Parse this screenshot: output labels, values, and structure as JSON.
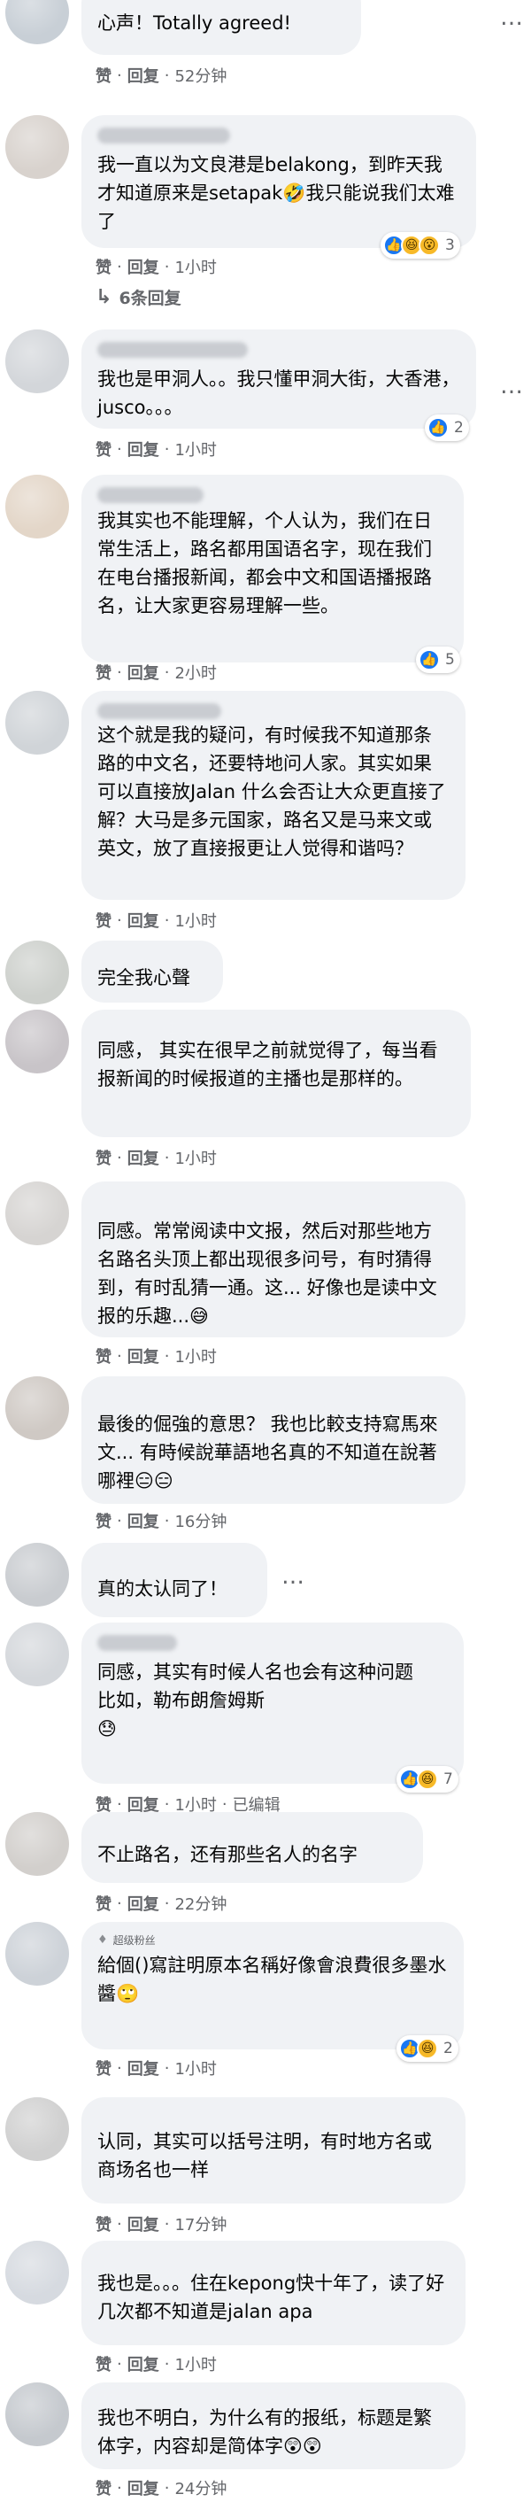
{
  "actions": {
    "like": "赞",
    "reply": "回复",
    "separator": "·",
    "more": "…"
  },
  "comments": [
    {
      "text": "心声！Totally agreed!",
      "time": "52分钟",
      "edited": ""
    },
    {
      "text": "我一直以为文良港是belakong，到昨天我才知道原来是setapak🤣我只能说我们太难了",
      "time": "1小时",
      "edited": "",
      "reactions": {
        "icons": [
          "like-icon",
          "haha-icon",
          "wow-icon"
        ],
        "count": "3"
      },
      "replies": "6条回复"
    },
    {
      "text": "我也是甲洞人。。我只懂甲洞大街，大香港，jusco。。。",
      "time": "1小时",
      "edited": "",
      "reactions": {
        "icons": [
          "like-icon"
        ],
        "count": "2"
      }
    },
    {
      "text": "我其实也不能理解，个人认为，我们在日常生活上，路名都用国语名字，现在我们在电台播报新闻，都会中文和国语播报路名，让大家更容易理解一些。",
      "time": "2小时",
      "edited": "",
      "reactions": {
        "icons": [
          "like-icon"
        ],
        "count": "5"
      }
    },
    {
      "text": "这个就是我的疑问，有时候我不知道那条路的中文名，还要特地问人家。其实如果可以直接放Jalan 什么会否让大众更直接了解？大马是多元国家，路名又是马来文或英文，放了直接报更让人觉得和谐吗？",
      "time": "1小时",
      "edited": ""
    },
    {
      "text": "完全我心聲",
      "time": "",
      "edited": ""
    },
    {
      "text": "同感， 其实在很早之前就觉得了，每当看报新闻的时候报道的主播也是那样的。",
      "time": "1小时",
      "edited": ""
    },
    {
      "text": "同感。常常阅读中文报，然后对那些地方名路名头顶上都出现很多问号，有时猜得到，有时乱猜一通。这... 好像也是读中文报的乐趣...😅",
      "time": "1小时",
      "edited": ""
    },
    {
      "text": "最後的倔強的意思？ 我也比較支持寫馬來文... 有時候說華語地名真的不知道在說著哪裡😑😑",
      "time": "16分钟",
      "edited": ""
    },
    {
      "text": "真的太认同了！",
      "time": "",
      "edited": ""
    },
    {
      "text": "同感，其实有时候人名也会有这种问题\n比如，勒布朗詹姆斯\n😓",
      "time": "1小时",
      "edited": "已编辑",
      "reactions": {
        "icons": [
          "like-icon",
          "haha-icon"
        ],
        "count": "7"
      }
    },
    {
      "text": "不止路名，还有那些名人的名字",
      "time": "22分钟",
      "edited": ""
    },
    {
      "badge": "超级粉丝",
      "text": "給個()寫註明原本名稱好像會浪費很多墨水醬🙄",
      "time": "1小时",
      "edited": "",
      "reactions": {
        "icons": [
          "like-icon",
          "haha-icon"
        ],
        "count": "2"
      }
    },
    {
      "text": "认同，其实可以括号注明，有时地方名或商场名也一样",
      "time": "17分钟",
      "edited": ""
    },
    {
      "text": "我也是。。。住在kepong快十年了，读了好几次都不知道是jalan apa",
      "time": "1小时",
      "edited": ""
    },
    {
      "text": "我也不明白，为什么有的报纸，标题是繁体字，内容却是简体字😲😲",
      "time": "24分钟",
      "edited": ""
    }
  ]
}
